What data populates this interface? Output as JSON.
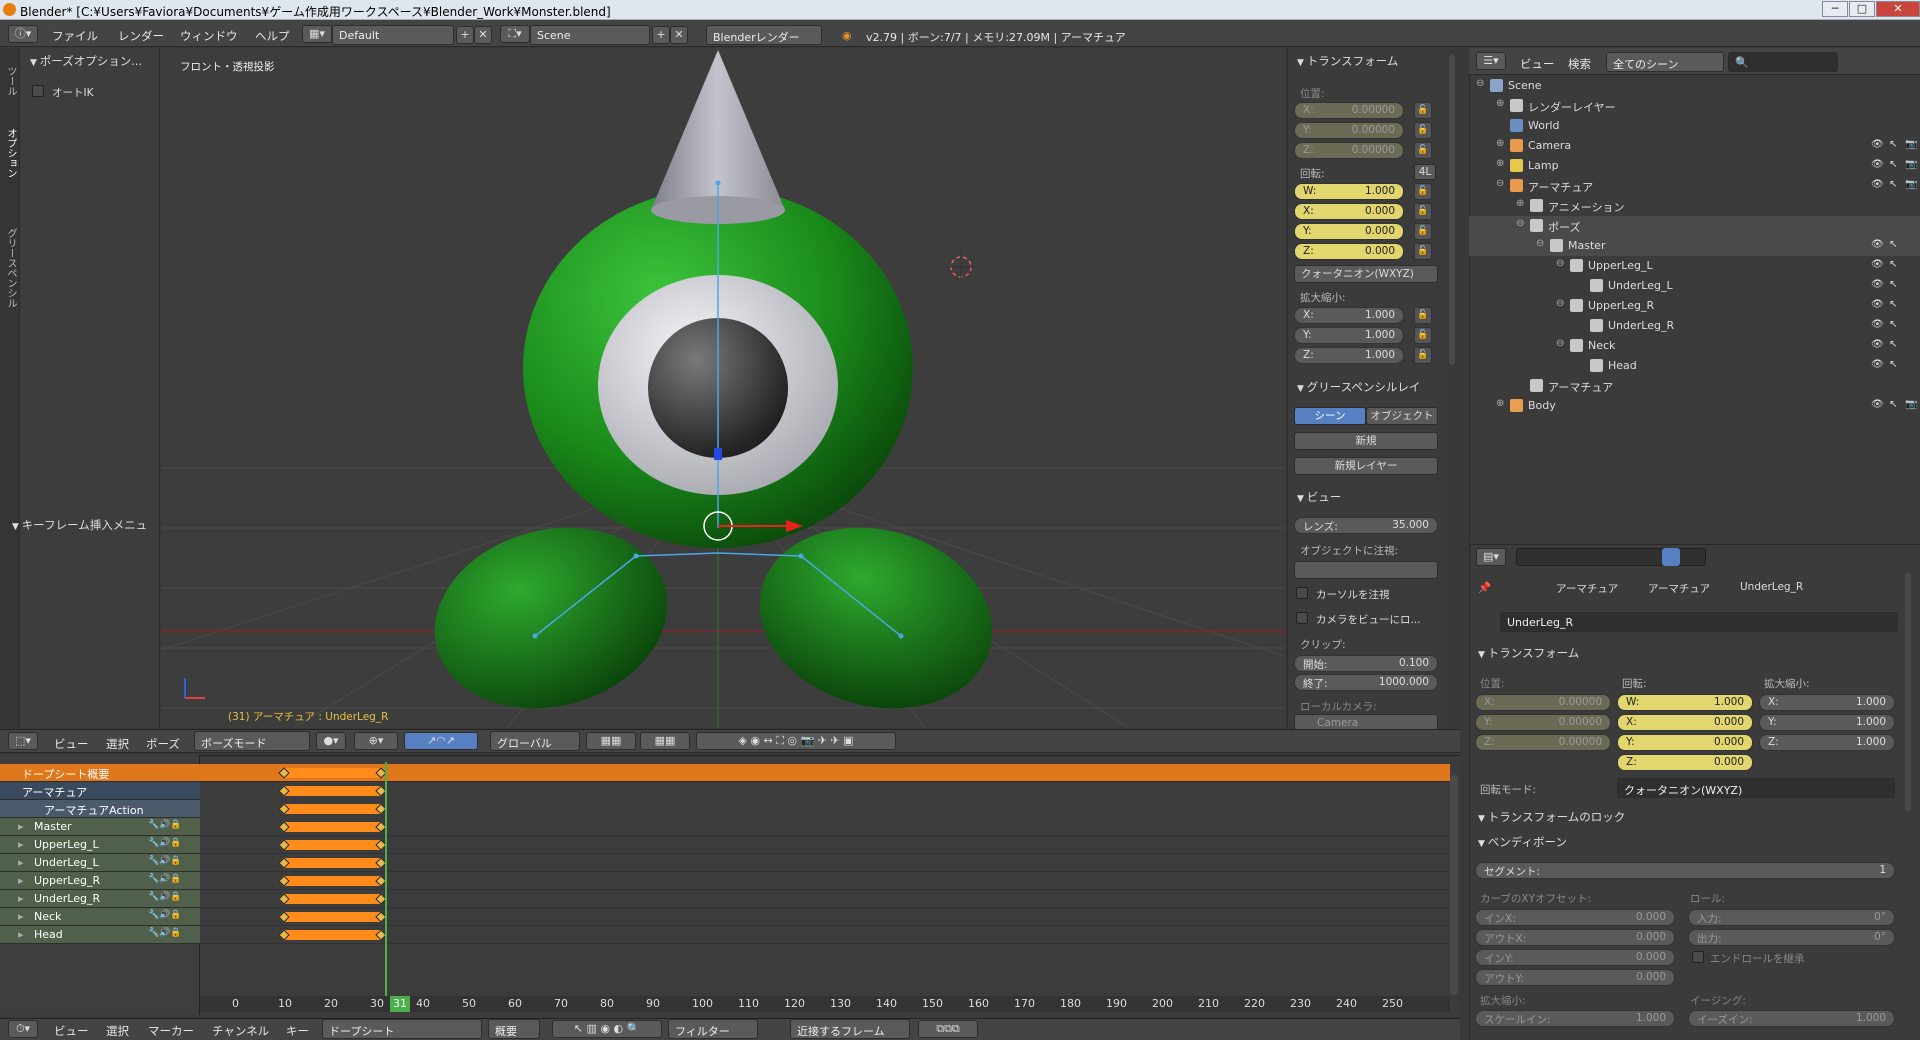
{
  "window": {
    "title": "Blender* [C:¥Users¥Faviora¥Documents¥ゲーム作成用ワークスペース¥Blender_Work¥Monster.blend]",
    "minimize": "─",
    "maximize": "□",
    "close": "✕"
  },
  "menubar": {
    "items": [
      "ファイル",
      "レンダー",
      "ウィンドウ",
      "ヘルプ"
    ],
    "layout": "Default",
    "scene": "Scene",
    "engine": "Blenderレンダー",
    "stats": "v2.79 | ボーン:7/7 | メモリ:27.09M | アーマチュア"
  },
  "toolshelf": {
    "tabs": [
      "ツール",
      "オプション",
      "グリースペンシル"
    ],
    "pose_options_header": "ポーズオプション...",
    "auto_ik_label": "オートIK",
    "keyframe_menu_header": "キーフレーム挿入メニュ"
  },
  "viewport": {
    "view_label": "フロント・透視投影",
    "status": "(31) アーマチュア : UnderLeg_R"
  },
  "npanel": {
    "transform_header": "トランスフォーム",
    "location_label": "位置:",
    "location": [
      {
        "k": "X:",
        "v": "0.00000"
      },
      {
        "k": "Y:",
        "v": "0.00000"
      },
      {
        "k": "Z:",
        "v": "0.00000"
      }
    ],
    "rotation_label": "回転:",
    "rotation_btn": "4L",
    "rotation": [
      {
        "k": "W:",
        "v": "1.000"
      },
      {
        "k": "X:",
        "v": "0.000"
      },
      {
        "k": "Y:",
        "v": "0.000"
      },
      {
        "k": "Z:",
        "v": "0.000"
      }
    ],
    "rot_mode": "クォータニオン(WXYZ)",
    "scale_label": "拡大縮小:",
    "scale": [
      {
        "k": "X:",
        "v": "1.000"
      },
      {
        "k": "Y:",
        "v": "1.000"
      },
      {
        "k": "Z:",
        "v": "1.000"
      }
    ],
    "gp_header": "グリースペンシルレイ",
    "gp_scene": "シーン",
    "gp_object": "オブジェクト",
    "gp_new": "新規",
    "gp_new_layer": "新規レイヤー",
    "view_header": "ビュー",
    "lens_label": "レンズ:",
    "lens": "35.000",
    "focus_label": "オブジェクトに注視:",
    "cursor_lock": "カーソルを注視",
    "camera_lock": "カメラをビューにロ...",
    "clip_label": "クリップ:",
    "clip_start_label": "開始:",
    "clip_start": "0.100",
    "clip_end_label": "終了:",
    "clip_end": "1000.000",
    "local_camera": "ローカルカメラ:",
    "camera_field": "Camera"
  },
  "outliner": {
    "menu_view": "ビュー",
    "menu_search": "検索",
    "filter": "全てのシーン",
    "rows": [
      {
        "label": "Scene",
        "indent": 0,
        "exp": "⊖",
        "color": "#8aa4c8",
        "eye": false
      },
      {
        "label": "レンダーレイヤー",
        "indent": 1,
        "exp": "⊕",
        "color": "#c8c8c8",
        "eye": false
      },
      {
        "label": "World",
        "indent": 1,
        "exp": "",
        "color": "#6b8fc4",
        "eye": false
      },
      {
        "label": "Camera",
        "indent": 1,
        "exp": "⊕",
        "color": "#e89a4a",
        "eye": true
      },
      {
        "label": "Lamp",
        "indent": 1,
        "exp": "⊕",
        "color": "#e8c84a",
        "eye": true
      },
      {
        "label": "アーマチュア",
        "indent": 1,
        "exp": "⊖",
        "color": "#e89a4a",
        "eye": true
      },
      {
        "label": "アニメーション",
        "indent": 2,
        "exp": "⊕",
        "color": "#c8c8c8",
        "eye": false
      },
      {
        "label": "ポーズ",
        "indent": 2,
        "exp": "⊖",
        "color": "#c8c8c8",
        "eye": false
      },
      {
        "label": "Master",
        "indent": 3,
        "exp": "⊖",
        "color": "#c8c8c8",
        "eye": true
      },
      {
        "label": "UpperLeg_L",
        "indent": 4,
        "exp": "⊖",
        "color": "#c8c8c8",
        "eye": true
      },
      {
        "label": "UnderLeg_L",
        "indent": 5,
        "exp": "",
        "color": "#c8c8c8",
        "eye": true
      },
      {
        "label": "UpperLeg_R",
        "indent": 4,
        "exp": "⊖",
        "color": "#c8c8c8",
        "eye": true
      },
      {
        "label": "UnderLeg_R",
        "indent": 5,
        "exp": "",
        "color": "#c8c8c8",
        "eye": true
      },
      {
        "label": "Neck",
        "indent": 4,
        "exp": "⊖",
        "color": "#c8c8c8",
        "eye": true
      },
      {
        "label": "Head",
        "indent": 5,
        "exp": "",
        "color": "#c8c8c8",
        "eye": true
      },
      {
        "label": "アーマチュア",
        "indent": 2,
        "exp": "",
        "color": "#c8c8c8",
        "eye": false
      },
      {
        "label": "Body",
        "indent": 1,
        "exp": "⊕",
        "color": "#e8a050",
        "eye": true
      }
    ]
  },
  "properties": {
    "breadcrumb": [
      "アーマチュア",
      "アーマチュア",
      "UnderLeg_R"
    ],
    "bone_name": "UnderLeg_R",
    "transform_header": "トランスフォーム",
    "loc_label": "位置:",
    "rot_label": "回転:",
    "scale_label": "拡大縮小:",
    "loc": [
      {
        "k": "X:",
        "v": "0.00000"
      },
      {
        "k": "Y:",
        "v": "0.00000"
      },
      {
        "k": "Z:",
        "v": "0.00000"
      }
    ],
    "rot": [
      {
        "k": "W:",
        "v": "1.000"
      },
      {
        "k": "X:",
        "v": "0.000"
      },
      {
        "k": "Y:",
        "v": "0.000"
      },
      {
        "k": "Z:",
        "v": "0.000"
      }
    ],
    "scale": [
      {
        "k": "X:",
        "v": "1.000"
      },
      {
        "k": "Y:",
        "v": "1.000"
      },
      {
        "k": "Z:",
        "v": "1.000"
      }
    ],
    "rot_mode_label": "回転モード:",
    "rot_mode": "クォータニオン(WXYZ)",
    "lock_header": "トランスフォームのロック",
    "bendy_header": "ベンディボーン",
    "segments_label": "セグメント:",
    "segments": "1",
    "curve_label": "カーブのXYオフセット:",
    "roll_label": "ロール:",
    "curve": [
      {
        "k": "インX:",
        "v": "0.000"
      },
      {
        "k": "アウトX:",
        "v": "0.000"
      },
      {
        "k": "インY:",
        "v": "0.000"
      },
      {
        "k": "アウトY:",
        "v": "0.000"
      }
    ],
    "roll": [
      {
        "k": "入力:",
        "v": "0°"
      },
      {
        "k": "出力:",
        "v": "0°"
      }
    ],
    "inherit_roll": "エンドロールを継承",
    "scale2_label": "拡大縮小:",
    "ease_label": "イージング:",
    "scale_in_label": "スケールイン:",
    "scale_in": "1.000",
    "ease_in_label": "イーズイン:",
    "ease_in": "1.000"
  },
  "viewport_header": {
    "menus": [
      "ビュー",
      "選択",
      "ポーズ"
    ],
    "mode": "ボーズモード",
    "orientation": "グローバル"
  },
  "dopesheet": {
    "summary": "ドープシート概要",
    "armature": "アーマチュア",
    "action": "アーマチュアAction",
    "channels": [
      "Master",
      "UpperLeg_L",
      "UnderLeg_L",
      "UpperLeg_R",
      "UnderLeg_R",
      "Neck",
      "Head"
    ],
    "key_start": 10,
    "key_end": 31,
    "current_frame": "31",
    "ruler": [
      "0",
      "10",
      "20",
      "30",
      "40",
      "50",
      "60",
      "70",
      "80",
      "90",
      "100",
      "110",
      "120",
      "130",
      "140",
      "150",
      "160",
      "170",
      "180",
      "190",
      "200",
      "210",
      "220",
      "230",
      "240",
      "250"
    ]
  },
  "bottombar": {
    "menus": [
      "ビュー",
      "選択",
      "マーカー",
      "チャンネル",
      "キー"
    ],
    "editor": "ドープシート",
    "summary_btn": "概要",
    "filter": "フィルター",
    "snap": "近接するフレーム"
  }
}
